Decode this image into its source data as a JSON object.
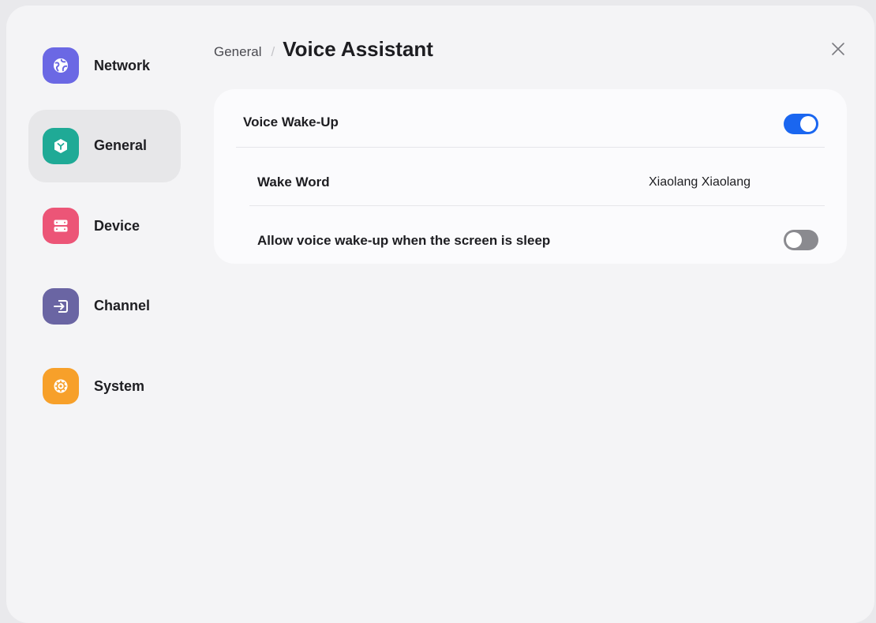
{
  "sidebar": {
    "items": [
      {
        "label": "Network",
        "icon": "globe-icon",
        "color": "#6b68e4",
        "active": false
      },
      {
        "label": "General",
        "icon": "cube-icon",
        "color": "#1faa96",
        "active": true
      },
      {
        "label": "Device",
        "icon": "server-icon",
        "color": "#ec5577",
        "active": false
      },
      {
        "label": "Channel",
        "icon": "input-arrow-icon",
        "color": "#6a65a3",
        "active": false
      },
      {
        "label": "System",
        "icon": "gear-icon",
        "color": "#f7a02a",
        "active": false
      }
    ]
  },
  "header": {
    "breadcrumb_parent": "General",
    "breadcrumb_separator": "/",
    "title": "Voice Assistant"
  },
  "settings": {
    "voice_wakeup": {
      "label": "Voice Wake-Up",
      "enabled": true
    },
    "wake_word": {
      "label": "Wake Word",
      "value": "Xiaolang Xiaolang"
    },
    "sleep_wakeup": {
      "label": "Allow voice wake-up when the screen is sleep",
      "enabled": false
    }
  },
  "colors": {
    "accent": "#1a66f0",
    "toggle_off": "#8a8a8f",
    "active_nav_bg": "#e7e7e9"
  }
}
